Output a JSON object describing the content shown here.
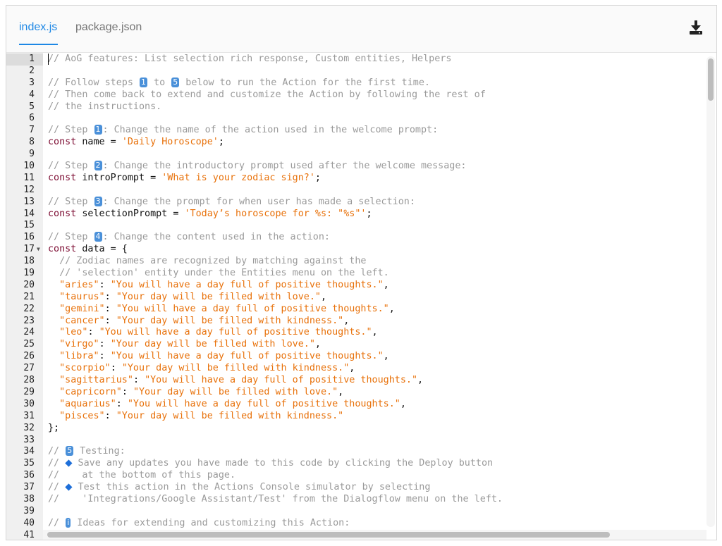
{
  "tabs": [
    {
      "label": "index.js",
      "active": true
    },
    {
      "label": "package.json",
      "active": false
    }
  ],
  "toolbar": {
    "download_icon": "download-icon"
  },
  "colors": {
    "accent": "#1e88e5",
    "comment": "#9a9a9a",
    "keyword": "#7d0d33",
    "string": "#e8710a"
  },
  "editor": {
    "folded_line": 17,
    "lines": [
      {
        "n": "1",
        "seg": [
          [
            "cm",
            "// AoG features: List selection rich response, Custom entities, Helpers"
          ]
        ]
      },
      {
        "n": "2",
        "seg": []
      },
      {
        "n": "3",
        "seg": [
          [
            "cm",
            "// Follow steps "
          ],
          [
            "em",
            "1"
          ],
          [
            "cm",
            " to "
          ],
          [
            "em",
            "5"
          ],
          [
            "cm",
            " below to run the Action for the first time."
          ]
        ]
      },
      {
        "n": "4",
        "seg": [
          [
            "cm",
            "// Then come back to extend and customize the Action by following the rest of"
          ]
        ]
      },
      {
        "n": "5",
        "seg": [
          [
            "cm",
            "// the instructions."
          ]
        ]
      },
      {
        "n": "6",
        "seg": []
      },
      {
        "n": "7",
        "seg": [
          [
            "cm",
            "// Step "
          ],
          [
            "em",
            "1"
          ],
          [
            "cm",
            ": Change the name of the action used in the welcome prompt:"
          ]
        ]
      },
      {
        "n": "8",
        "seg": [
          [
            "kw",
            "const"
          ],
          [
            "tx",
            " name = "
          ],
          [
            "str",
            "'Daily Horoscope'"
          ],
          [
            "tx",
            ";"
          ]
        ]
      },
      {
        "n": "9",
        "seg": []
      },
      {
        "n": "10",
        "seg": [
          [
            "cm",
            "// Step "
          ],
          [
            "em",
            "2"
          ],
          [
            "cm",
            ": Change the introductory prompt used after the welcome message:"
          ]
        ]
      },
      {
        "n": "11",
        "seg": [
          [
            "kw",
            "const"
          ],
          [
            "tx",
            " introPrompt = "
          ],
          [
            "str",
            "'What is your zodiac sign?'"
          ],
          [
            "tx",
            ";"
          ]
        ]
      },
      {
        "n": "12",
        "seg": []
      },
      {
        "n": "13",
        "seg": [
          [
            "cm",
            "// Step "
          ],
          [
            "em",
            "3"
          ],
          [
            "cm",
            ": Change the prompt for when user has made a selection:"
          ]
        ]
      },
      {
        "n": "14",
        "seg": [
          [
            "kw",
            "const"
          ],
          [
            "tx",
            " selectionPrompt = "
          ],
          [
            "str",
            "'Today’s horoscope for %s: \"%s\"'"
          ],
          [
            "tx",
            ";"
          ]
        ]
      },
      {
        "n": "15",
        "seg": []
      },
      {
        "n": "16",
        "seg": [
          [
            "cm",
            "// Step "
          ],
          [
            "em",
            "4"
          ],
          [
            "cm",
            ": Change the content used in the action:"
          ]
        ]
      },
      {
        "n": "17",
        "seg": [
          [
            "kw",
            "const"
          ],
          [
            "tx",
            " data = {"
          ]
        ]
      },
      {
        "n": "18",
        "seg": [
          [
            "tx",
            "  "
          ],
          [
            "cm",
            "// Zodiac names are recognized by matching against the"
          ]
        ]
      },
      {
        "n": "19",
        "seg": [
          [
            "tx",
            "  "
          ],
          [
            "cm",
            "// 'selection' entity under the Entities menu on the left."
          ]
        ]
      },
      {
        "n": "20",
        "seg": [
          [
            "tx",
            "  "
          ],
          [
            "str",
            "\"aries\""
          ],
          [
            "tx",
            ": "
          ],
          [
            "str",
            "\"You will have a day full of positive thoughts.\""
          ],
          [
            "tx",
            ","
          ]
        ]
      },
      {
        "n": "21",
        "seg": [
          [
            "tx",
            "  "
          ],
          [
            "str",
            "\"taurus\""
          ],
          [
            "tx",
            ": "
          ],
          [
            "str",
            "\"Your day will be filled with love.\""
          ],
          [
            "tx",
            ","
          ]
        ]
      },
      {
        "n": "22",
        "seg": [
          [
            "tx",
            "  "
          ],
          [
            "str",
            "\"gemini\""
          ],
          [
            "tx",
            ": "
          ],
          [
            "str",
            "\"You will have a day full of positive thoughts.\""
          ],
          [
            "tx",
            ","
          ]
        ]
      },
      {
        "n": "23",
        "seg": [
          [
            "tx",
            "  "
          ],
          [
            "str",
            "\"cancer\""
          ],
          [
            "tx",
            ": "
          ],
          [
            "str",
            "\"Your day will be filled with kindness.\""
          ],
          [
            "tx",
            ","
          ]
        ]
      },
      {
        "n": "24",
        "seg": [
          [
            "tx",
            "  "
          ],
          [
            "str",
            "\"leo\""
          ],
          [
            "tx",
            ": "
          ],
          [
            "str",
            "\"You will have a day full of positive thoughts.\""
          ],
          [
            "tx",
            ","
          ]
        ]
      },
      {
        "n": "25",
        "seg": [
          [
            "tx",
            "  "
          ],
          [
            "str",
            "\"virgo\""
          ],
          [
            "tx",
            ": "
          ],
          [
            "str",
            "\"Your day will be filled with love.\""
          ],
          [
            "tx",
            ","
          ]
        ]
      },
      {
        "n": "26",
        "seg": [
          [
            "tx",
            "  "
          ],
          [
            "str",
            "\"libra\""
          ],
          [
            "tx",
            ": "
          ],
          [
            "str",
            "\"You will have a day full of positive thoughts.\""
          ],
          [
            "tx",
            ","
          ]
        ]
      },
      {
        "n": "27",
        "seg": [
          [
            "tx",
            "  "
          ],
          [
            "str",
            "\"scorpio\""
          ],
          [
            "tx",
            ": "
          ],
          [
            "str",
            "\"Your day will be filled with kindness.\""
          ],
          [
            "tx",
            ","
          ]
        ]
      },
      {
        "n": "28",
        "seg": [
          [
            "tx",
            "  "
          ],
          [
            "str",
            "\"sagittarius\""
          ],
          [
            "tx",
            ": "
          ],
          [
            "str",
            "\"You will have a day full of positive thoughts.\""
          ],
          [
            "tx",
            ","
          ]
        ]
      },
      {
        "n": "29",
        "seg": [
          [
            "tx",
            "  "
          ],
          [
            "str",
            "\"capricorn\""
          ],
          [
            "tx",
            ": "
          ],
          [
            "str",
            "\"Your day will be filled with love.\""
          ],
          [
            "tx",
            ","
          ]
        ]
      },
      {
        "n": "30",
        "seg": [
          [
            "tx",
            "  "
          ],
          [
            "str",
            "\"aquarius\""
          ],
          [
            "tx",
            ": "
          ],
          [
            "str",
            "\"You will have a day full of positive thoughts.\""
          ],
          [
            "tx",
            ","
          ]
        ]
      },
      {
        "n": "31",
        "seg": [
          [
            "tx",
            "  "
          ],
          [
            "str",
            "\"pisces\""
          ],
          [
            "tx",
            ": "
          ],
          [
            "str",
            "\"Your day will be filled with kindness.\""
          ]
        ]
      },
      {
        "n": "32",
        "seg": [
          [
            "tx",
            "};"
          ]
        ]
      },
      {
        "n": "33",
        "seg": []
      },
      {
        "n": "34",
        "seg": [
          [
            "cm",
            "// "
          ],
          [
            "em",
            "5"
          ],
          [
            "cm",
            " Testing:"
          ]
        ]
      },
      {
        "n": "35",
        "seg": [
          [
            "cm",
            "// "
          ],
          [
            "dm",
            "◆"
          ],
          [
            "cm",
            " Save any updates you have made to this code by clicking the Deploy button"
          ]
        ]
      },
      {
        "n": "36",
        "seg": [
          [
            "cm",
            "//    at the bottom of this page."
          ]
        ]
      },
      {
        "n": "37",
        "seg": [
          [
            "cm",
            "// "
          ],
          [
            "dm",
            "◆"
          ],
          [
            "cm",
            " Test this action in the Actions Console simulator by selecting"
          ]
        ]
      },
      {
        "n": "38",
        "seg": [
          [
            "cm",
            "//    'Integrations/Google Assistant/Test' from the Dialogflow menu on the left."
          ]
        ]
      },
      {
        "n": "39",
        "seg": []
      },
      {
        "n": "40",
        "seg": [
          [
            "cm",
            "// "
          ],
          [
            "em",
            "i"
          ],
          [
            "cm",
            " Ideas for extending and customizing this Action:"
          ]
        ]
      },
      {
        "n": "41",
        "seg": []
      }
    ]
  }
}
